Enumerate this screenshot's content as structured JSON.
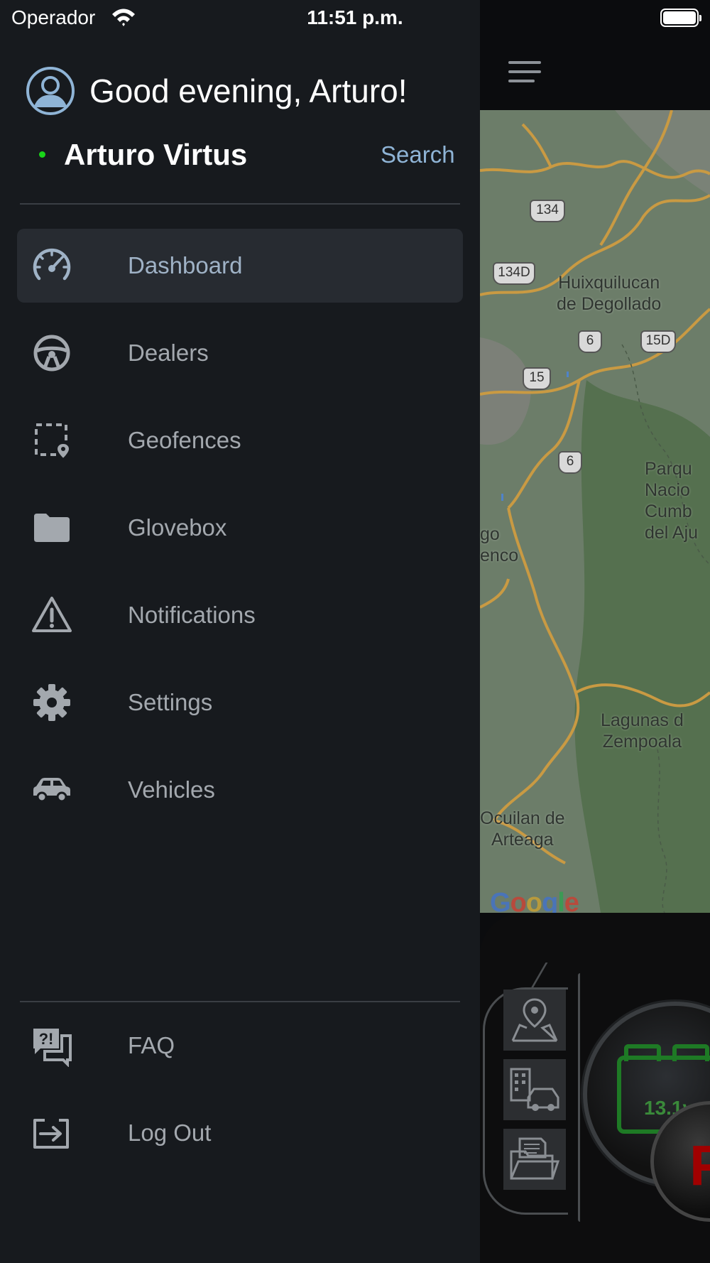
{
  "status_bar": {
    "carrier": "Operador",
    "time": "11:51 p.m."
  },
  "drawer": {
    "greeting": "Good evening, Arturo!",
    "user_name": "Arturo Virtus",
    "search_label": "Search",
    "menu_items": [
      {
        "label": "Dashboard",
        "icon": "speedometer-icon",
        "active": true
      },
      {
        "label": "Dealers",
        "icon": "steering-wheel-icon",
        "active": false
      },
      {
        "label": "Geofences",
        "icon": "geofence-icon",
        "active": false
      },
      {
        "label": "Glovebox",
        "icon": "folder-icon",
        "active": false
      },
      {
        "label": "Notifications",
        "icon": "warning-icon",
        "active": false
      },
      {
        "label": "Settings",
        "icon": "gear-icon",
        "active": false
      },
      {
        "label": "Vehicles",
        "icon": "car-icon",
        "active": false
      }
    ],
    "footer_items": [
      {
        "label": "FAQ",
        "icon": "faq-icon"
      },
      {
        "label": "Log Out",
        "icon": "logout-icon"
      }
    ]
  },
  "map": {
    "labels": [
      {
        "text": "Huixquilucan\nde Degollado"
      },
      {
        "text": "Parqu\nNacio\nCumb\ndel Aju"
      },
      {
        "text": "Lagunas d\nZempoala"
      },
      {
        "text": "Ocuilan de\nArteaga"
      },
      {
        "text": "go\nenco"
      }
    ],
    "road_shields": [
      "134",
      "134D",
      "6",
      "15D",
      "15",
      "6"
    ],
    "attribution": "Google"
  },
  "dashboard_panel": {
    "battery_voltage": "13.1v",
    "gauge_letter": "F"
  },
  "colors": {
    "drawer_bg": "#171a1e",
    "active_item_bg": "#272b31",
    "online_dot": "#19d519",
    "search_link": "#8fb4d6",
    "avatar_accent": "#8fb4d6"
  }
}
